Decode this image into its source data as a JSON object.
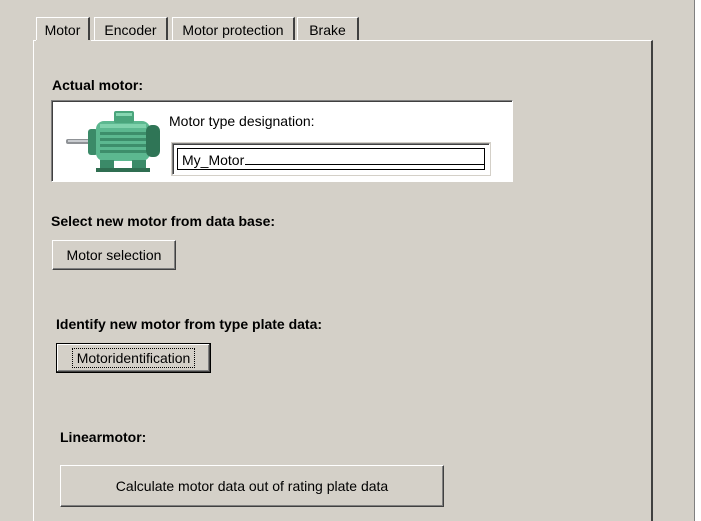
{
  "tabs": [
    {
      "label": "Motor",
      "active": true
    },
    {
      "label": "Encoder",
      "active": false
    },
    {
      "label": "Motor protection",
      "active": false
    },
    {
      "label": "Brake",
      "active": false
    }
  ],
  "actual_motor": {
    "heading": "Actual motor:",
    "image_icon": "electric-motor-image",
    "field_label": "Motor type designation:",
    "field_value": "My_Motor"
  },
  "database": {
    "heading": "Select new motor from data base:",
    "button_label": "Motor selection"
  },
  "type_plate": {
    "heading": "Identify new motor from type plate data:",
    "button_label": "Motoridentification"
  },
  "linear": {
    "heading": "Linearmotor:",
    "button_label": "Calculate motor data out of rating plate data"
  }
}
